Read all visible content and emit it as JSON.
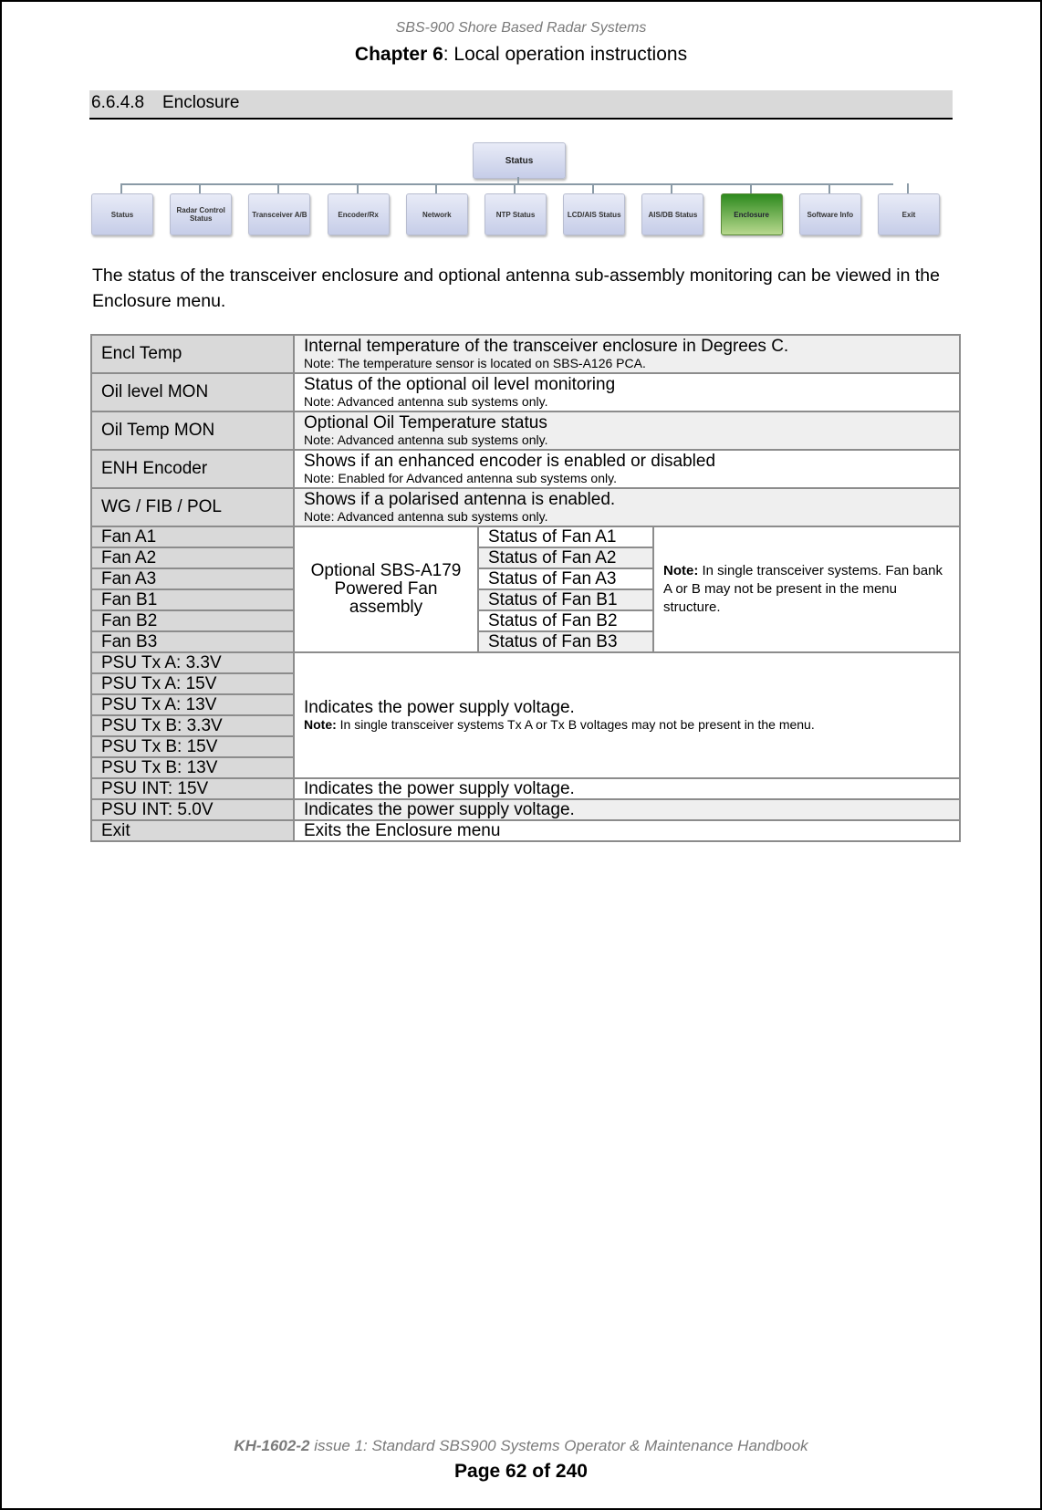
{
  "header": {
    "doc_title": "SBS-900 Shore Based Radar Systems",
    "chapter_label": "Chapter 6",
    "chapter_title": ": Local operation instructions"
  },
  "section": {
    "number": "6.6.4.8",
    "title": "Enclosure"
  },
  "menu_diagram": {
    "root": "Status",
    "items": [
      {
        "label": "Status",
        "active": false
      },
      {
        "label": "Radar Control Status",
        "active": false
      },
      {
        "label": "Transceiver A/B",
        "active": false
      },
      {
        "label": "Encoder/Rx",
        "active": false
      },
      {
        "label": "Network",
        "active": false
      },
      {
        "label": "NTP Status",
        "active": false
      },
      {
        "label": "LCD/AIS Status",
        "active": false
      },
      {
        "label": "AIS/DB Status",
        "active": false
      },
      {
        "label": "Enclosure",
        "active": true
      },
      {
        "label": "Software Info",
        "active": false
      },
      {
        "label": "Exit",
        "active": false
      }
    ],
    "active_color": "#3a8f24"
  },
  "intro": "The status of the transceiver enclosure and optional antenna sub-assembly monitoring can be viewed in the Enclosure menu.",
  "table": {
    "rows": [
      {
        "key": "Encl Temp",
        "desc": "Internal temperature of the transceiver enclosure in Degrees C.",
        "note": "Note: The temperature sensor is located on SBS-A126 PCA."
      },
      {
        "key": "Oil level MON",
        "desc": "Status of the optional oil level monitoring",
        "note": "Note: Advanced antenna sub systems only."
      },
      {
        "key": "Oil Temp MON",
        "desc": "Optional Oil Temperature status",
        "note": "Note: Advanced antenna sub systems only."
      },
      {
        "key": "ENH Encoder",
        "desc": "Shows if an enhanced encoder is enabled or disabled",
        "note": "Note: Enabled for Advanced antenna sub systems only."
      },
      {
        "key": "WG / FIB / POL",
        "desc": "Shows if a polarised antenna is enabled.",
        "note": "Note: Advanced antenna sub systems only."
      }
    ],
    "fans": {
      "keys": [
        "Fan A1",
        "Fan A2",
        "Fan A3",
        "Fan B1",
        "Fan B2",
        "Fan B3"
      ],
      "group_desc": "Optional SBS-A179 Powered Fan assembly",
      "statuses": [
        "Status of Fan A1",
        "Status of Fan A2",
        "Status of Fan A3",
        "Status of Fan B1",
        "Status of Fan B2",
        "Status of Fan B3"
      ],
      "note_label": "Note:",
      "note_text": " In single transceiver systems. Fan bank A or B may not be present in the menu structure."
    },
    "psu": {
      "keys": [
        "PSU Tx A: 3.3V",
        "PSU Tx A: 15V",
        "PSU Tx A: 13V",
        "PSU Tx B: 3.3V",
        "PSU Tx B: 15V",
        "PSU Tx B: 13V"
      ],
      "desc": "Indicates the power supply voltage.",
      "note_label": "Note:",
      "note_text": " In single transceiver systems Tx A or Tx B voltages may not be present in the menu."
    },
    "tail": [
      {
        "key": "PSU INT: 15V",
        "desc": "Indicates the power supply voltage."
      },
      {
        "key": "PSU INT: 5.0V",
        "desc": "Indicates the power supply voltage."
      },
      {
        "key": "Exit",
        "desc": "Exits the Enclosure menu"
      }
    ]
  },
  "footer": {
    "doc_code": "KH-1602-2",
    "doc_desc": " issue 1: Standard SBS900 Systems Operator & Maintenance Handbook",
    "page": "Page 62 of 240"
  }
}
